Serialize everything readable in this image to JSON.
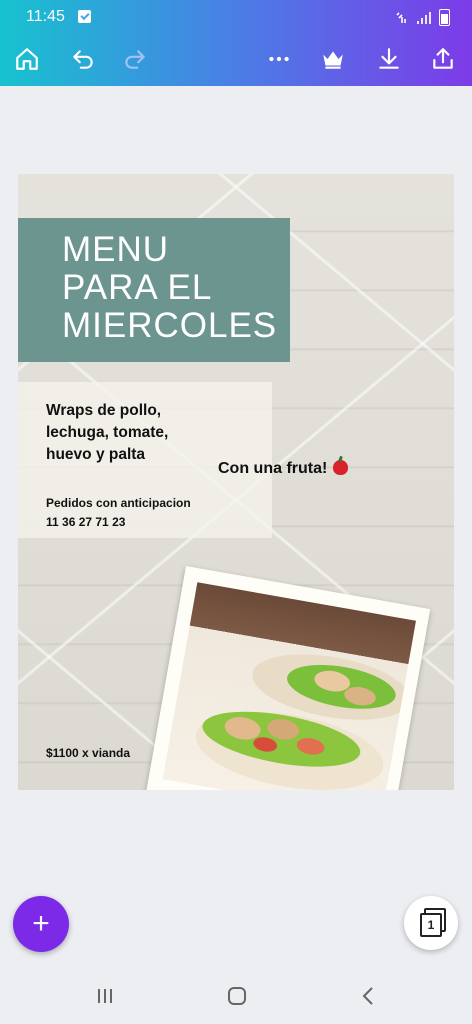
{
  "status": {
    "time": "11:45"
  },
  "colors": {
    "accent": "#7d2ae8",
    "title_block": "#6c9590"
  },
  "toolbar": {
    "icons": [
      "home-icon",
      "undo-icon",
      "redo-icon",
      "more-icon",
      "crown-icon",
      "download-icon",
      "share-icon"
    ]
  },
  "design": {
    "title_lines": [
      "MENU",
      "PARA EL",
      "MIERCOLES"
    ],
    "dish_lines": [
      "Wraps de pollo,",
      "lechuga, tomate,",
      "huevo y palta"
    ],
    "fruit": "Con una fruta!",
    "orders_line1": "Pedidos con anticipacion",
    "orders_line2": "11 36 27 71 23",
    "price": "$1100 x vianda"
  },
  "pages": {
    "count": "1"
  },
  "fab": {
    "label": "+"
  }
}
